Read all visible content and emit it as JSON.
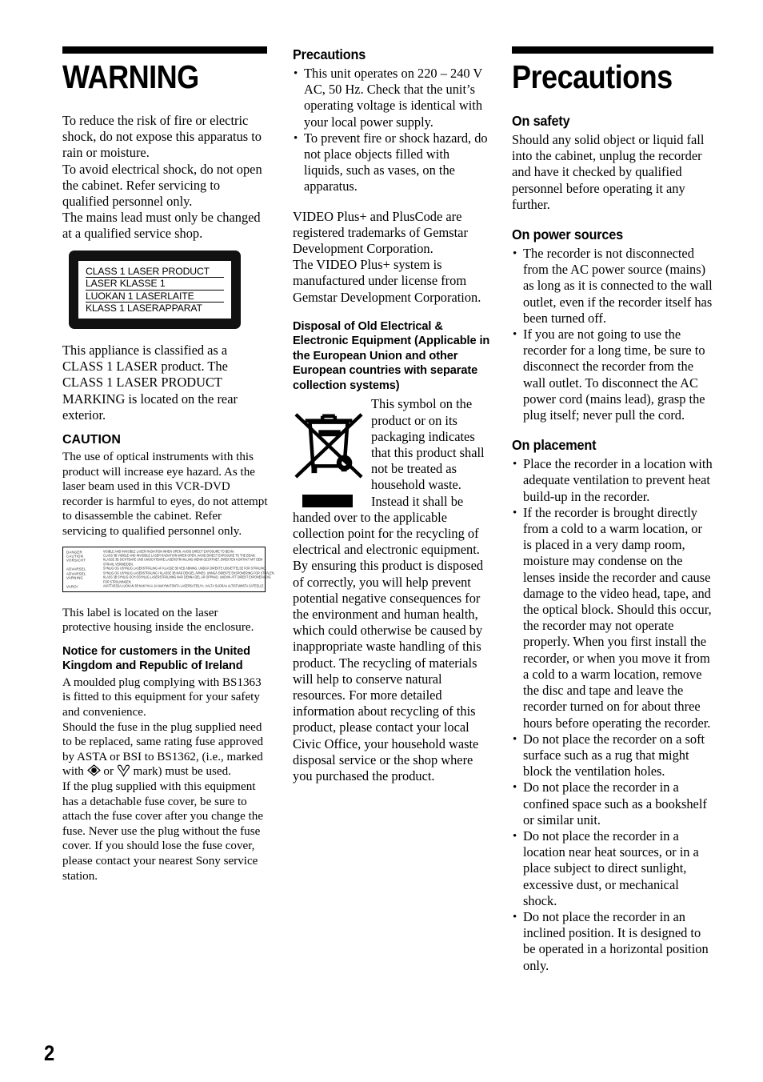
{
  "page": {
    "number": "2"
  },
  "column1": {
    "heading": "WARNING",
    "intro": [
      "To reduce the risk of fire or electric shock, do not expose this apparatus to rain or moisture.",
      "To avoid electrical shock, do not open the cabinet. Refer servicing to qualified personnel only.",
      "The mains lead must only be changed at a qualified service shop."
    ],
    "laser_label": {
      "lines": [
        "CLASS 1 LASER PRODUCT",
        "LASER KLASSE 1",
        "LUOKAN 1 LASERLAITE",
        "KLASS 1 LASERAPPARAT"
      ]
    },
    "classification": "This appliance is classified as a CLASS 1 LASER product. The CLASS 1 LASER PRODUCT MARKING is located on the rear exterior.",
    "caution_heading": "CAUTION",
    "caution_body": "The use of optical instruments with this product will increase eye hazard. As the laser beam used in this VCR-DVD recorder is harmful to eyes, do not attempt to disassemble the cabinet. Refer servicing to qualified personnel only.",
    "multilingual_label": {
      "terms": [
        "DANGER",
        "CAUTION",
        "VORSICHT",
        "",
        "ADVARSEL",
        "ADVARSEL",
        "VARNING",
        "",
        "VARO!"
      ],
      "texts": [
        "VISIBLE AND INVISIBLE LASER RADIATION WHEN OPEN. AVOID DIRECT EXPOSURE TO BEAM.",
        "CLASS 3B VISIBLE AND INVISIBLE LASER RADIATION WHEN OPEN. AVOID DIRECT EXPOSURE TO THE BEAM.",
        "KLASSE 3B SICHTBARE UND UNSICHTBARE LASERSTRAHLUNG WENN GEÖFFNET. DIREKTEN KONTAKT MIT DEM",
        "STRAHL VERMEIDEN.",
        "SYNLIG OG USYNLIG LASERSTRÅLING AF KLASSE 3B VED ÅBNING. UNDGÅ DIREKTE UDSÆTTELSE FOR STRÅLING.",
        "SYNLIG OG USYNLIG LASERSTRÅLING I KLASSE 3B NÅR DEKSEL ÅPNES. UNNGÅ DIREKTE EKSPONERING FOR STRÅLEN.",
        "KLASS 3B SYNLIG OCH OSYNLIG LASERSTRÅLNING NÄR DENNA DEL ÄR ÖPPNAD. UNDVIK ATT DIREKT EXPONERA DIG",
        "FÖR STRÅLNINGEN.",
        "AVATTAESSA LUOKAN 3B NÄKYVÄÄ JA NÄKYMÄTÖNTÄ LASERSÄTEILYÄ. VÄLTÄ SUORAA ALTISTUMISTA SÄTEELLE."
      ]
    },
    "label_location": "This label is located on the laser protective housing inside the enclosure.",
    "uk_notice_heading": "Notice for customers in the United Kingdom and Republic of Ireland",
    "uk_notice_p1_a": "A moulded plug complying with BS1363 is fitted to this equipment for your safety and convenience.",
    "uk_notice_p1_b": "Should the fuse in the plug supplied need to be replaced, same rating fuse approved by ASTA or BSI to BS1362, (i.e., marked with",
    "uk_notice_p1_or": "or",
    "uk_notice_p1_c": "mark) must be used.",
    "uk_notice_p2": "If the plug supplied with this equipment has a detachable fuse cover, be sure to attach the fuse cover after you change the fuse. Never use the plug without the fuse cover. If you should lose the fuse cover, please contact your nearest Sony service station.",
    "marks": {
      "asta": "asta-approval-mark",
      "bsi": "bsi-kitemark"
    }
  },
  "column2": {
    "heading": "Precautions",
    "bullets": [
      "This unit operates on 220 – 240 V AC, 50 Hz. Check that the unit’s operating voltage is identical with your local power supply.",
      "To prevent fire or shock hazard, do not place objects filled with liquids, such as vases, on the apparatus."
    ],
    "trademark": "VIDEO Plus+ and PlusCode are registered trademarks of Gemstar Development Corporation.\nThe VIDEO Plus+ system is manufactured under license from Gemstar Development Corporation.",
    "trademark_l1": "VIDEO Plus+ and PlusCode are registered trademarks of Gemstar Development Corporation.",
    "trademark_l2": "The VIDEO Plus+ system is manufactured under license from Gemstar Development Corporation.",
    "weee_heading": "Disposal of Old Electrical & Electronic Equipment (Applicable in the European Union and other European countries with separate collection systems)",
    "weee_body": "This symbol on the product or on its packaging indicates that this product shall not be treated as household waste. Instead it shall be handed over to the applicable collection point for the recycling of electrical and electronic equipment. By ensuring this product is disposed of correctly, you will help prevent potential negative consequences for the environment and human health, which could otherwise be caused by inappropriate waste handling of this product. The recycling of materials will help to conserve natural resources. For more detailed information about recycling of this product, please contact your local Civic Office, your household waste disposal service or the shop where you purchased the product.",
    "weee_icon": "crossed-out-wheeled-bin-icon"
  },
  "column3": {
    "heading": "Precautions",
    "sections": [
      {
        "heading": "On safety",
        "paragraph": "Should any solid object or liquid fall into the cabinet, unplug the recorder and have it checked by qualified personnel before operating it any further.",
        "bullets": []
      },
      {
        "heading": "On power sources",
        "paragraph": "",
        "bullets": [
          "The recorder is not disconnected from the AC power source (mains) as long as it is connected to the wall outlet, even if the recorder itself has been turned off.",
          "If you are not going to use the recorder for a long time, be sure to disconnect the recorder from the wall outlet. To disconnect the AC power cord (mains lead), grasp the plug itself; never pull the cord."
        ]
      },
      {
        "heading": "On placement",
        "paragraph": "",
        "bullets": [
          "Place the recorder in a location with adequate ventilation to prevent heat build-up in the recorder.",
          "If the recorder is brought directly from a cold to a warm location, or is placed in a very damp room, moisture may condense on the lenses inside the recorder and cause damage to the video head, tape, and the optical block. Should this occur, the recorder may not operate properly. When you first install the recorder, or when you move it from a cold to a warm location, remove the disc and tape and leave the recorder turned on for about three hours before operating the recorder.",
          "Do not place the recorder on a soft surface such as a rug that might block the ventilation holes.",
          "Do not place the recorder in a confined space such as a bookshelf or similar unit.",
          "Do not place the recorder in a location near heat sources, or in a place subject to direct sunlight, excessive dust, or mechanical shock.",
          "Do not place the recorder in an inclined position. It is designed to be operated in a horizontal position only."
        ]
      }
    ]
  }
}
